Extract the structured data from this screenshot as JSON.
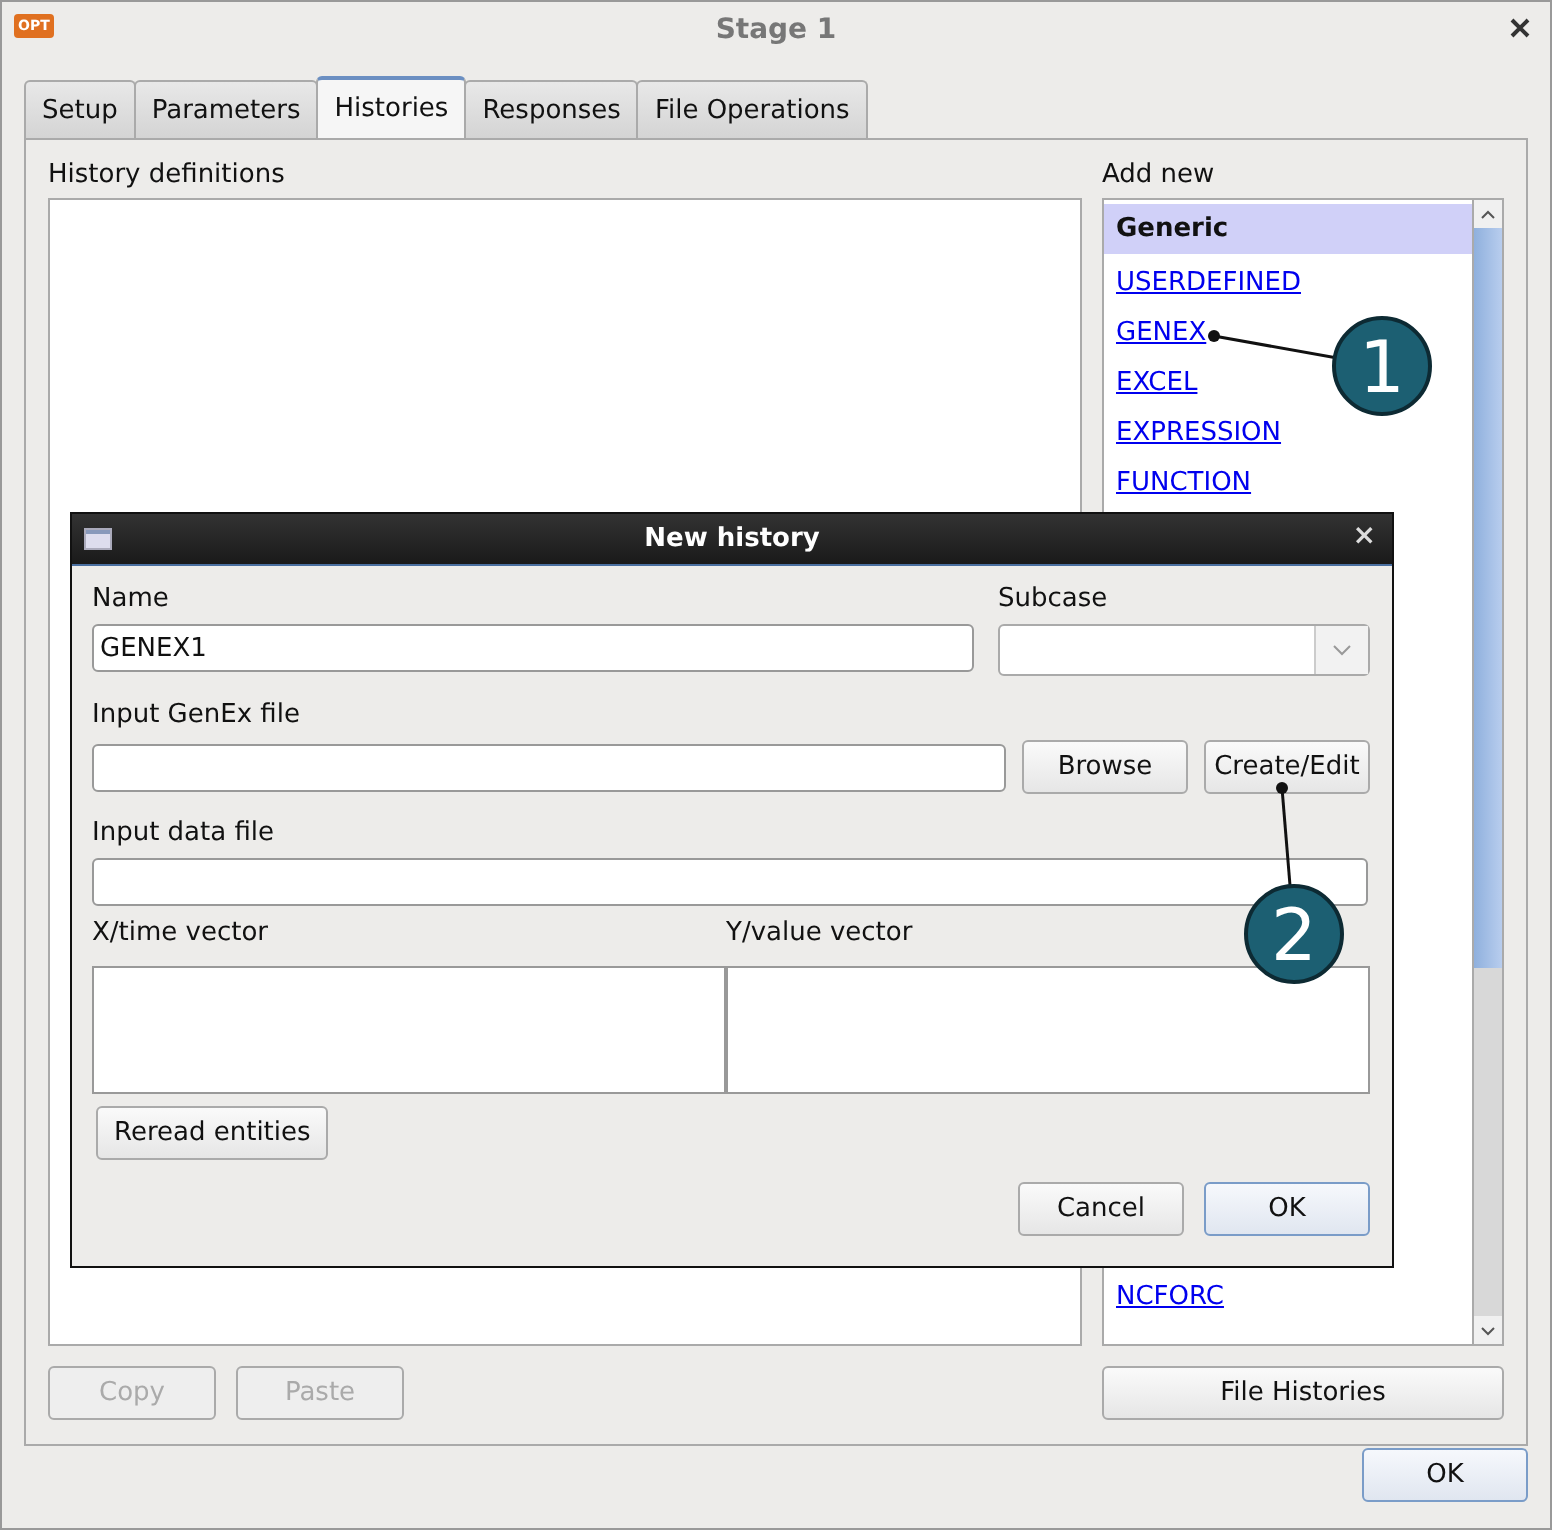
{
  "window": {
    "title": "Stage 1",
    "app_icon_text": "OPT"
  },
  "tabs": [
    {
      "label": "Setup",
      "selected": false
    },
    {
      "label": "Parameters",
      "selected": false
    },
    {
      "label": "Histories",
      "selected": true
    },
    {
      "label": "Responses",
      "selected": false
    },
    {
      "label": "File Operations",
      "selected": false
    }
  ],
  "history_definitions": {
    "label": "History definitions"
  },
  "add_new": {
    "label": "Add new",
    "items_top": [
      {
        "kind": "header",
        "label": "Generic"
      },
      {
        "kind": "link",
        "label": "USERDEFINED"
      },
      {
        "kind": "link",
        "label": "GENEX"
      },
      {
        "kind": "link",
        "label": "EXCEL"
      },
      {
        "kind": "link",
        "label": "EXPRESSION"
      },
      {
        "kind": "link",
        "label": "FUNCTION"
      }
    ],
    "items_bottom": [
      {
        "kind": "link",
        "label": "NCFORC"
      }
    ]
  },
  "left_buttons": [
    {
      "label": "Copy",
      "disabled": true
    },
    {
      "label": "Paste",
      "disabled": true
    }
  ],
  "file_histories_button": {
    "label": "File Histories",
    "disabled": false
  },
  "ok_button": {
    "label": "OK",
    "default": true
  },
  "dialog": {
    "title": "New history",
    "close": "×",
    "name": {
      "label": "Name",
      "value": "GENEX1"
    },
    "subcase": {
      "label": "Subcase"
    },
    "genex_file": {
      "label": "Input GenEx file"
    },
    "browse": {
      "label": "Browse",
      "default": false
    },
    "create_edit": {
      "label": "Create/Edit",
      "default": false
    },
    "data_file": {
      "label": "Input data file"
    },
    "x_vector": {
      "label": "X/time vector"
    },
    "y_vector": {
      "label": "Y/value vector"
    },
    "reread": {
      "label": "Reread entities",
      "default": false
    },
    "buttons": [
      {
        "label": "Cancel",
        "default": false
      },
      {
        "label": "OK",
        "default": true
      }
    ]
  },
  "callouts": [
    {
      "number": "1"
    },
    {
      "number": "2"
    }
  ]
}
